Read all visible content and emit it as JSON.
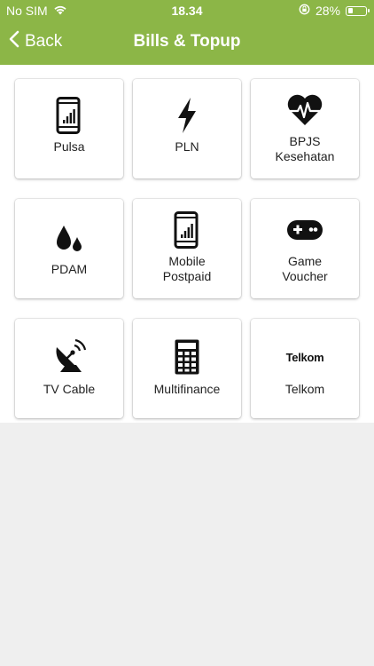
{
  "status_bar": {
    "carrier": "No SIM",
    "time": "18.34",
    "battery_percent": "28%",
    "battery_level": 0.28
  },
  "nav": {
    "back_label": "Back",
    "title": "Bills & Topup"
  },
  "tiles": [
    {
      "label": "Pulsa",
      "icon": "phone-signal-icon"
    },
    {
      "label": "PLN",
      "icon": "lightning-icon"
    },
    {
      "label": "BPJS\nKesehatan",
      "icon": "heart-pulse-icon"
    },
    {
      "label": "PDAM",
      "icon": "water-drops-icon"
    },
    {
      "label": "Mobile\nPostpaid",
      "icon": "phone-signal-icon"
    },
    {
      "label": "Game\nVoucher",
      "icon": "gamepad-icon"
    },
    {
      "label": "TV Cable",
      "icon": "satellite-dish-icon"
    },
    {
      "label": "Multifinance",
      "icon": "calculator-icon"
    },
    {
      "label": "Telkom",
      "icon": "telkom-logo-icon",
      "logo_text": "Telkom"
    }
  ],
  "colors": {
    "header": "#8cb647",
    "background": "#efefef"
  }
}
